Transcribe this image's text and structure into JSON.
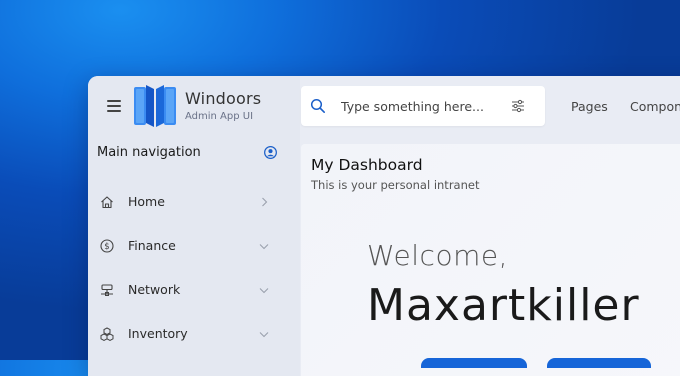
{
  "app": {
    "title": "Windoors",
    "subtitle": "Admin App UI",
    "logo_icon": "windoors-logo-icon",
    "menu_icon": "hamburger-menu-icon"
  },
  "search": {
    "placeholder": "Type something here...",
    "search_icon": "search-icon",
    "filter_icon": "filter-sliders-icon"
  },
  "topnav": {
    "items": [
      {
        "label": "Pages"
      },
      {
        "label": "Compon"
      }
    ]
  },
  "sidebar": {
    "header": "Main navigation",
    "header_icon": "user-circle-icon",
    "items": [
      {
        "label": "Home",
        "icon": "home-icon",
        "chevron": "chevron-right-icon"
      },
      {
        "label": "Finance",
        "icon": "dollar-circle-icon",
        "chevron": "chevron-down-icon"
      },
      {
        "label": "Network",
        "icon": "network-icon",
        "chevron": "chevron-down-icon"
      },
      {
        "label": "Inventory",
        "icon": "cubes-icon",
        "chevron": "chevron-down-icon"
      }
    ]
  },
  "main": {
    "title": "My Dashboard",
    "subtitle": "This is your personal intranet",
    "welcome": "Welcome,",
    "username": "Maxartkiller"
  },
  "colors": {
    "accent": "#1565d8",
    "background_blue": "#0f6fdc",
    "sidebar_bg": "#e4e8f1",
    "logo_blue": "#1e6fe0"
  }
}
